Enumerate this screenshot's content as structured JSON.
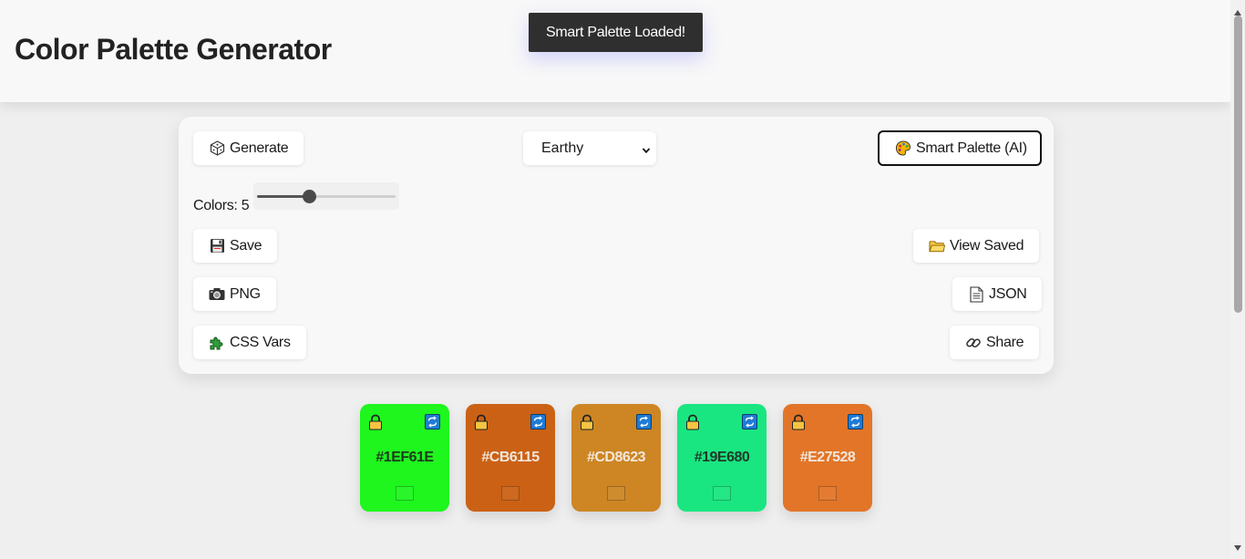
{
  "header": {
    "title": "Color Palette Generator"
  },
  "toast": {
    "message": "Smart Palette Loaded!"
  },
  "controls": {
    "generate_label": "Generate",
    "mode_select": {
      "selected": "Earthy"
    },
    "smart_label": "Smart Palette (AI)",
    "colors_label": "Colors: 5",
    "slider": {
      "value": 5,
      "min": 2,
      "max": 10
    },
    "save_label": "Save",
    "view_saved_label": "View Saved",
    "png_label": "PNG",
    "json_label": "JSON",
    "css_vars_label": "CSS Vars",
    "share_label": "Share"
  },
  "palette": [
    {
      "hex": "#1EF61E",
      "color": "#1EF61E",
      "text_color": "#1d3a1d"
    },
    {
      "hex": "#CB6115",
      "color": "#CB6115",
      "text_color": "#f2e6dc"
    },
    {
      "hex": "#CD8623",
      "color": "#CD8623",
      "text_color": "#f2e6dc"
    },
    {
      "hex": "#19E680",
      "color": "#19E680",
      "text_color": "#1d3a2a"
    },
    {
      "hex": "#E27528",
      "color": "#E27528",
      "text_color": "#f2e6dc"
    }
  ],
  "icons": {
    "generate": "dice-icon",
    "smart": "palette-icon",
    "save": "floppy-icon",
    "view_saved": "folder-icon",
    "png": "camera-icon",
    "json": "document-icon",
    "css_vars": "puzzle-icon",
    "share": "link-icon",
    "lock": "lock-icon",
    "refresh": "refresh-icon"
  }
}
